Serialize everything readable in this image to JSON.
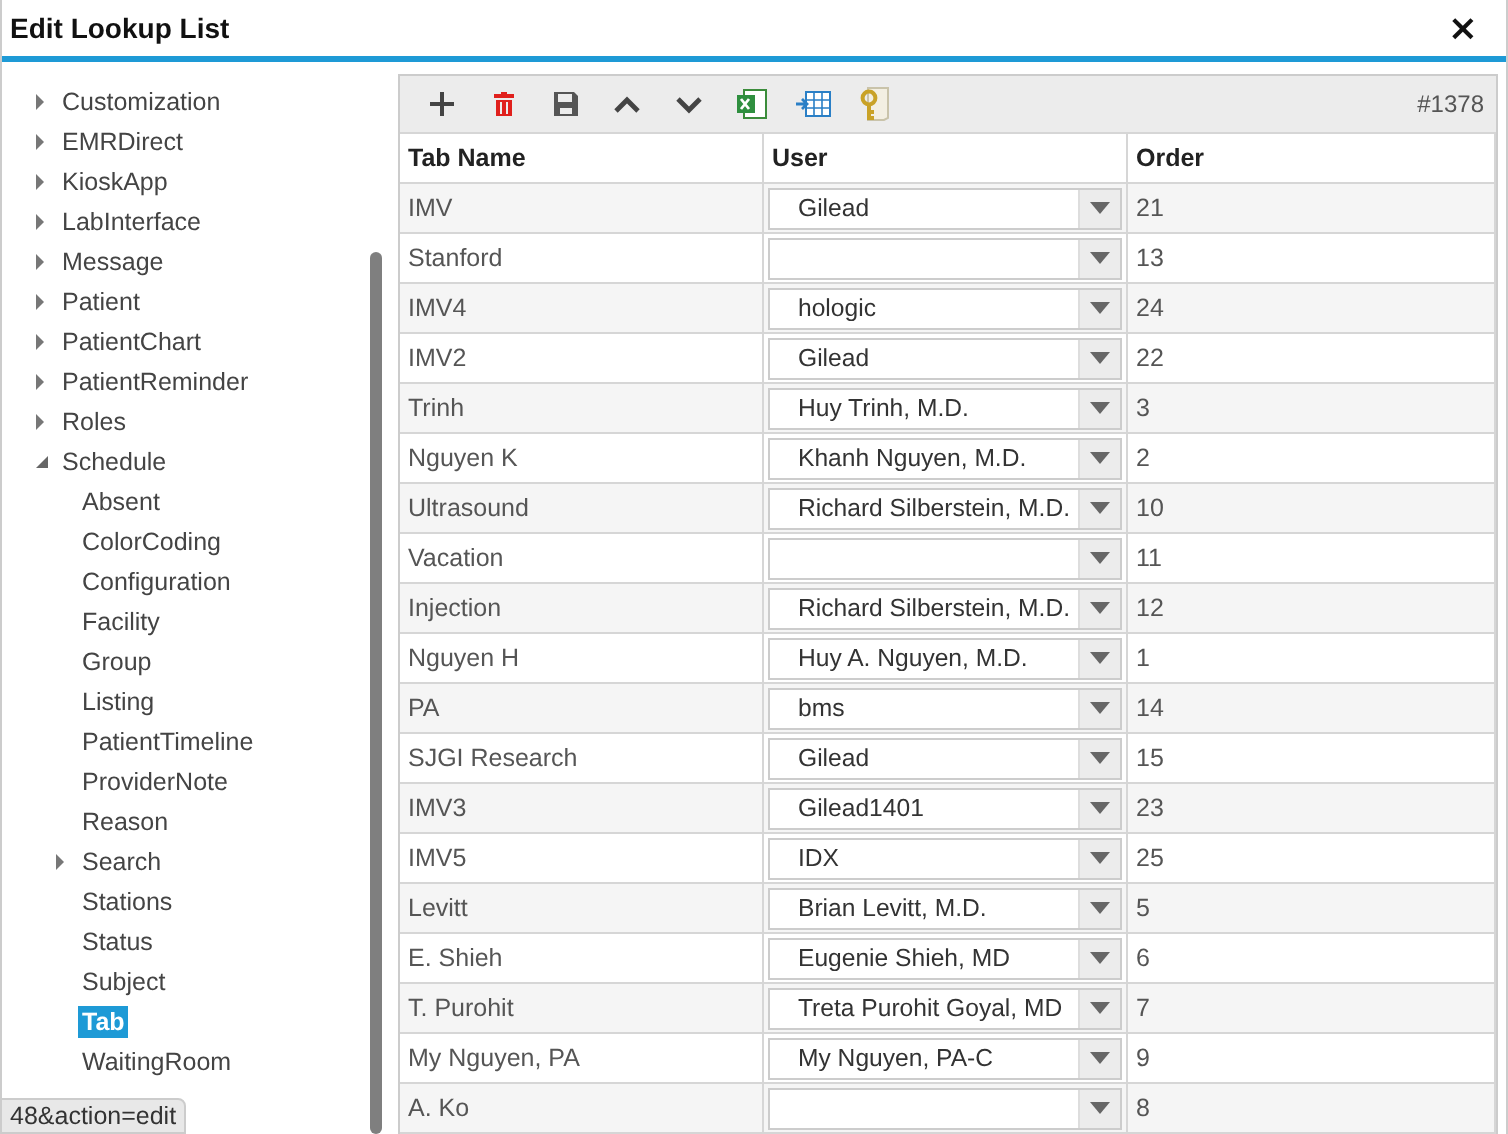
{
  "window": {
    "title": "Edit Lookup List",
    "close": "×"
  },
  "tree": [
    {
      "label": "Customization",
      "expanded": false
    },
    {
      "label": "EMRDirect",
      "expanded": false
    },
    {
      "label": "KioskApp",
      "expanded": false
    },
    {
      "label": "LabInterface",
      "expanded": false
    },
    {
      "label": "Message",
      "expanded": false
    },
    {
      "label": "Patient",
      "expanded": false
    },
    {
      "label": "PatientChart",
      "expanded": false
    },
    {
      "label": "PatientReminder",
      "expanded": false
    },
    {
      "label": "Roles",
      "expanded": false
    },
    {
      "label": "Schedule",
      "expanded": true,
      "children": [
        {
          "label": "Absent",
          "selected": false
        },
        {
          "label": "ColorCoding",
          "selected": false
        },
        {
          "label": "Configuration",
          "selected": false
        },
        {
          "label": "Facility",
          "selected": false
        },
        {
          "label": "Group",
          "selected": false
        },
        {
          "label": "Listing",
          "selected": false
        },
        {
          "label": "PatientTimeline",
          "selected": false
        },
        {
          "label": "ProviderNote",
          "selected": false
        },
        {
          "label": "Reason",
          "selected": false
        },
        {
          "label": "Search",
          "selected": false,
          "expanded": false
        },
        {
          "label": "Stations",
          "selected": false
        },
        {
          "label": "Status",
          "selected": false
        },
        {
          "label": "Subject",
          "selected": false
        },
        {
          "label": "Tab",
          "selected": true
        },
        {
          "label": "WaitingRoom",
          "selected": false
        }
      ]
    }
  ],
  "status_url": "48&action=edit",
  "toolbar": {
    "tools": [
      {
        "kind": "add"
      },
      {
        "kind": "delete"
      },
      {
        "kind": "save"
      },
      {
        "kind": "up"
      },
      {
        "kind": "down"
      },
      {
        "kind": "excel"
      },
      {
        "kind": "import"
      },
      {
        "kind": "key"
      }
    ],
    "record": "#1378"
  },
  "table": {
    "columns": [
      "Tab Name",
      "User",
      "Order"
    ],
    "rows": [
      {
        "tab_name": "IMV",
        "user": "Gilead",
        "order": "21"
      },
      {
        "tab_name": "Stanford",
        "order": "13"
      },
      {
        "tab_name": "IMV4",
        "user": "hologic",
        "order": "24"
      },
      {
        "tab_name": "IMV2",
        "user": "Gilead",
        "order": "22"
      },
      {
        "tab_name": "Trinh",
        "user": "Huy Trinh, M.D.",
        "order": "3"
      },
      {
        "tab_name": "Nguyen K",
        "user": "Khanh Nguyen, M.D.",
        "order": "2"
      },
      {
        "tab_name": "Ultrasound",
        "user": "Richard Silberstein, M.D.",
        "order": "10"
      },
      {
        "tab_name": "Vacation",
        "order": "11"
      },
      {
        "tab_name": "Injection",
        "user": "Richard Silberstein, M.D.",
        "order": "12"
      },
      {
        "tab_name": "Nguyen H",
        "user": "Huy A. Nguyen, M.D.",
        "order": "1"
      },
      {
        "tab_name": "PA",
        "user": "bms",
        "order": "14"
      },
      {
        "tab_name": "SJGI Research",
        "user": "Gilead",
        "order": "15"
      },
      {
        "tab_name": "IMV3",
        "user": "Gilead1401",
        "order": "23"
      },
      {
        "tab_name": "IMV5",
        "user": "IDX",
        "order": "25"
      },
      {
        "tab_name": "Levitt",
        "user": "Brian Levitt, M.D.",
        "order": "5"
      },
      {
        "tab_name": "E. Shieh",
        "user": "Eugenie Shieh, MD",
        "order": "6"
      },
      {
        "tab_name": "T. Purohit",
        "user": "Treta Purohit Goyal, MD",
        "order": "7"
      },
      {
        "tab_name": "My Nguyen, PA",
        "user": "My Nguyen, PA-C",
        "order": "9"
      },
      {
        "tab_name": "A. Ko",
        "order": "8"
      }
    ]
  }
}
